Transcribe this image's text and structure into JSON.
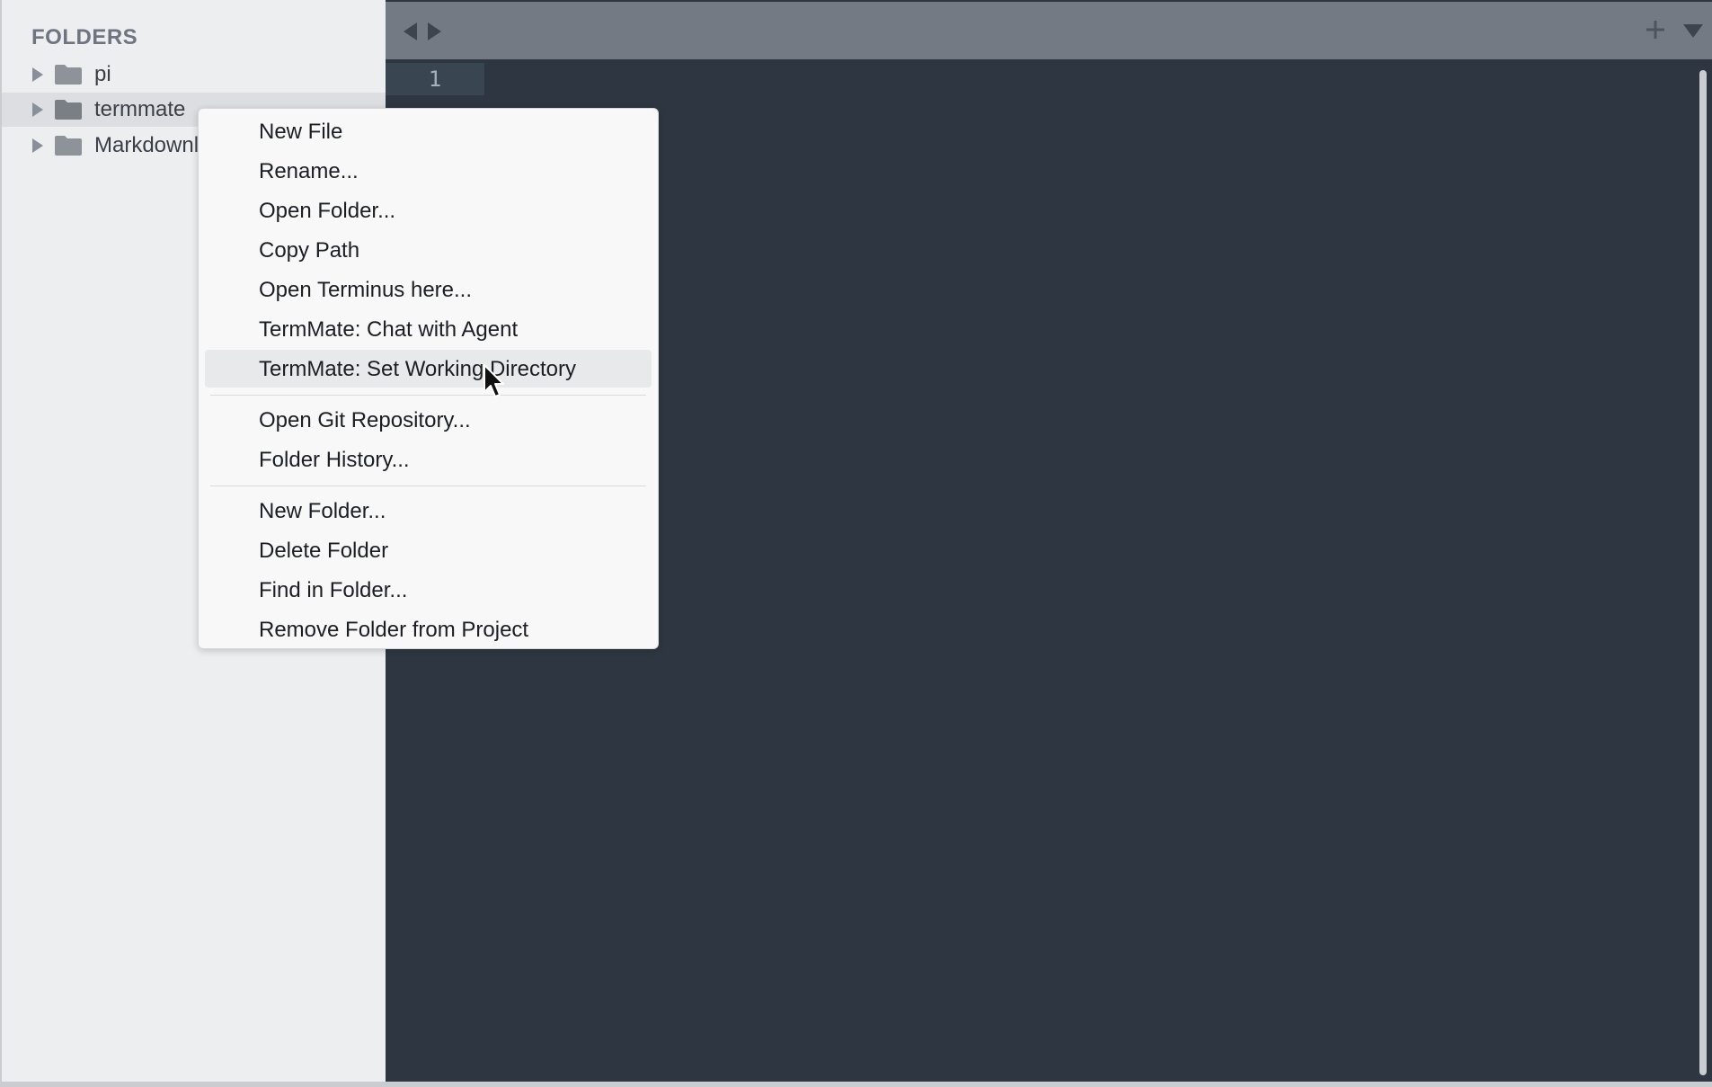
{
  "sidebar": {
    "header": "FOLDERS",
    "items": [
      {
        "label": "pi",
        "icon": "folder-icon"
      },
      {
        "label": "termmate",
        "icon": "folder-icon",
        "selected": true
      },
      {
        "label": "Markdownl",
        "icon": "folder-icon"
      }
    ]
  },
  "tabbar": {
    "nav_left_icon": "chevron-left-icon",
    "nav_right_icon": "chevron-right-icon",
    "new_tab_icon": "plus-icon",
    "tab_menu_icon": "chevron-down-icon"
  },
  "editor": {
    "line_numbers": [
      "1"
    ]
  },
  "context_menu": {
    "groups": [
      [
        {
          "label": "New File"
        },
        {
          "label": "Rename..."
        },
        {
          "label": "Open Folder..."
        },
        {
          "label": "Copy Path"
        },
        {
          "label": "Open Terminus here..."
        },
        {
          "label": "TermMate: Chat with Agent"
        },
        {
          "label": "TermMate: Set Working Directory",
          "hovered": true
        }
      ],
      [
        {
          "label": "Open Git Repository..."
        },
        {
          "label": "Folder History..."
        }
      ],
      [
        {
          "label": "New Folder..."
        },
        {
          "label": "Delete Folder"
        },
        {
          "label": "Find in Folder..."
        },
        {
          "label": "Remove Folder from Project"
        }
      ]
    ]
  },
  "colors": {
    "sidebar_bg": "#edeef0",
    "editor_bg": "#2e3741",
    "tabbar_bg": "#737a84",
    "menu_bg": "#f8f8f8",
    "menu_hover": "#e8e9eb"
  }
}
